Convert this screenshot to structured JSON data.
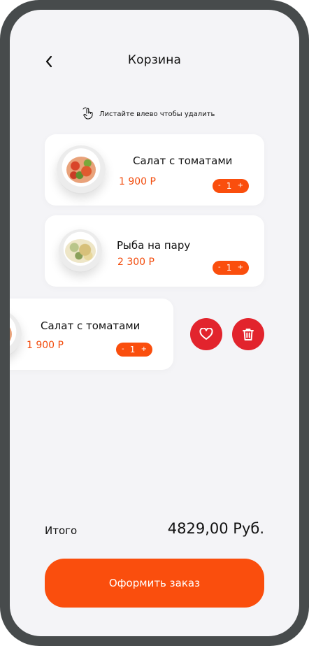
{
  "header": {
    "title": "Корзина",
    "back_icon": "chevron-left-icon"
  },
  "hint": {
    "text": "Листайте влево чтобы удалить",
    "icon": "swipe-hand-icon"
  },
  "cart": [
    {
      "name": "Салат с томатами",
      "price": "1 900 Р",
      "qty": "1",
      "minus": "-",
      "plus": "+"
    },
    {
      "name": "Рыба на пару",
      "price": "2 300 Р",
      "qty": "1",
      "minus": "-",
      "plus": "+"
    },
    {
      "name": "Салат с томатами",
      "price": "1 900 Р",
      "qty": "1",
      "minus": "-",
      "plus": "+"
    }
  ],
  "swipe_actions": {
    "favorite_icon": "heart-icon",
    "delete_icon": "trash-icon"
  },
  "summary": {
    "label": "Итого",
    "value": "4829,00 Руб."
  },
  "checkout": {
    "label": "Оформить заказ"
  },
  "colors": {
    "accent": "#fa4e0d",
    "danger": "#e2242d",
    "background": "#f4f4f7",
    "frame": "#474b4c"
  }
}
